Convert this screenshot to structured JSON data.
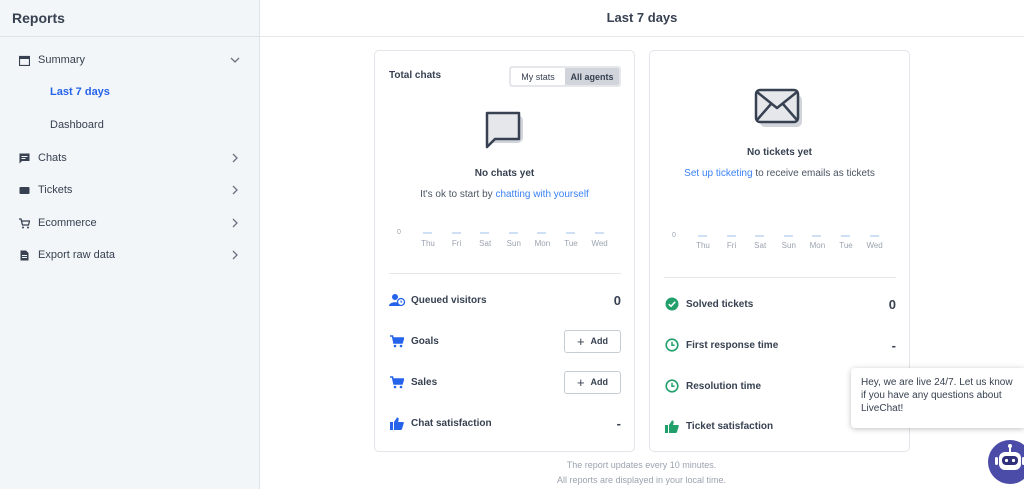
{
  "sidebar": {
    "title": "Reports",
    "items": [
      {
        "label": "Summary",
        "icon": "calendar-icon"
      },
      {
        "label": "Chats",
        "icon": "chat-icon"
      },
      {
        "label": "Tickets",
        "icon": "ticket-icon"
      },
      {
        "label": "Ecommerce",
        "icon": "cart-icon"
      },
      {
        "label": "Export raw data",
        "icon": "file-icon"
      }
    ],
    "sub_items": [
      {
        "label": "Last 7 days",
        "active": true
      },
      {
        "label": "Dashboard",
        "active": false
      }
    ]
  },
  "header": {
    "title": "Last 7 days"
  },
  "chats_card": {
    "title": "Total chats",
    "toggle": [
      "My stats",
      "All agents"
    ],
    "empty_title": "No chats yet",
    "empty_text_prefix": "It's ok to start by ",
    "empty_link": "chatting with yourself",
    "zero_label": "0",
    "days": [
      "Thu",
      "Fri",
      "Sat",
      "Sun",
      "Mon",
      "Tue",
      "Wed"
    ],
    "rows": [
      {
        "label": "Queued visitors",
        "value": "0"
      },
      {
        "label": "Goals",
        "button": "Add"
      },
      {
        "label": "Sales",
        "button": "Add"
      },
      {
        "label": "Chat satisfaction",
        "value": "-"
      }
    ]
  },
  "tickets_card": {
    "empty_title": "No tickets yet",
    "empty_link": "Set up ticketing",
    "empty_text_suffix": " to receive emails as tickets",
    "zero_label": "0",
    "days": [
      "Thu",
      "Fri",
      "Sat",
      "Sun",
      "Mon",
      "Tue",
      "Wed"
    ],
    "rows": [
      {
        "label": "Solved tickets",
        "value": "0"
      },
      {
        "label": "First response time",
        "value": "-"
      },
      {
        "label": "Resolution time",
        "value": ""
      },
      {
        "label": "Ticket satisfaction",
        "value": ""
      }
    ]
  },
  "footer": {
    "line1": "The report updates every 10 minutes.",
    "line2": "All reports are displayed in your local time."
  },
  "chat_widget": {
    "message": "Hey, we are live 24/7. Let us know if you have any questions about LiveChat!"
  },
  "colors": {
    "accent": "#3b82f6",
    "success": "#22a06b",
    "brand_bot": "#4b4ba8"
  }
}
